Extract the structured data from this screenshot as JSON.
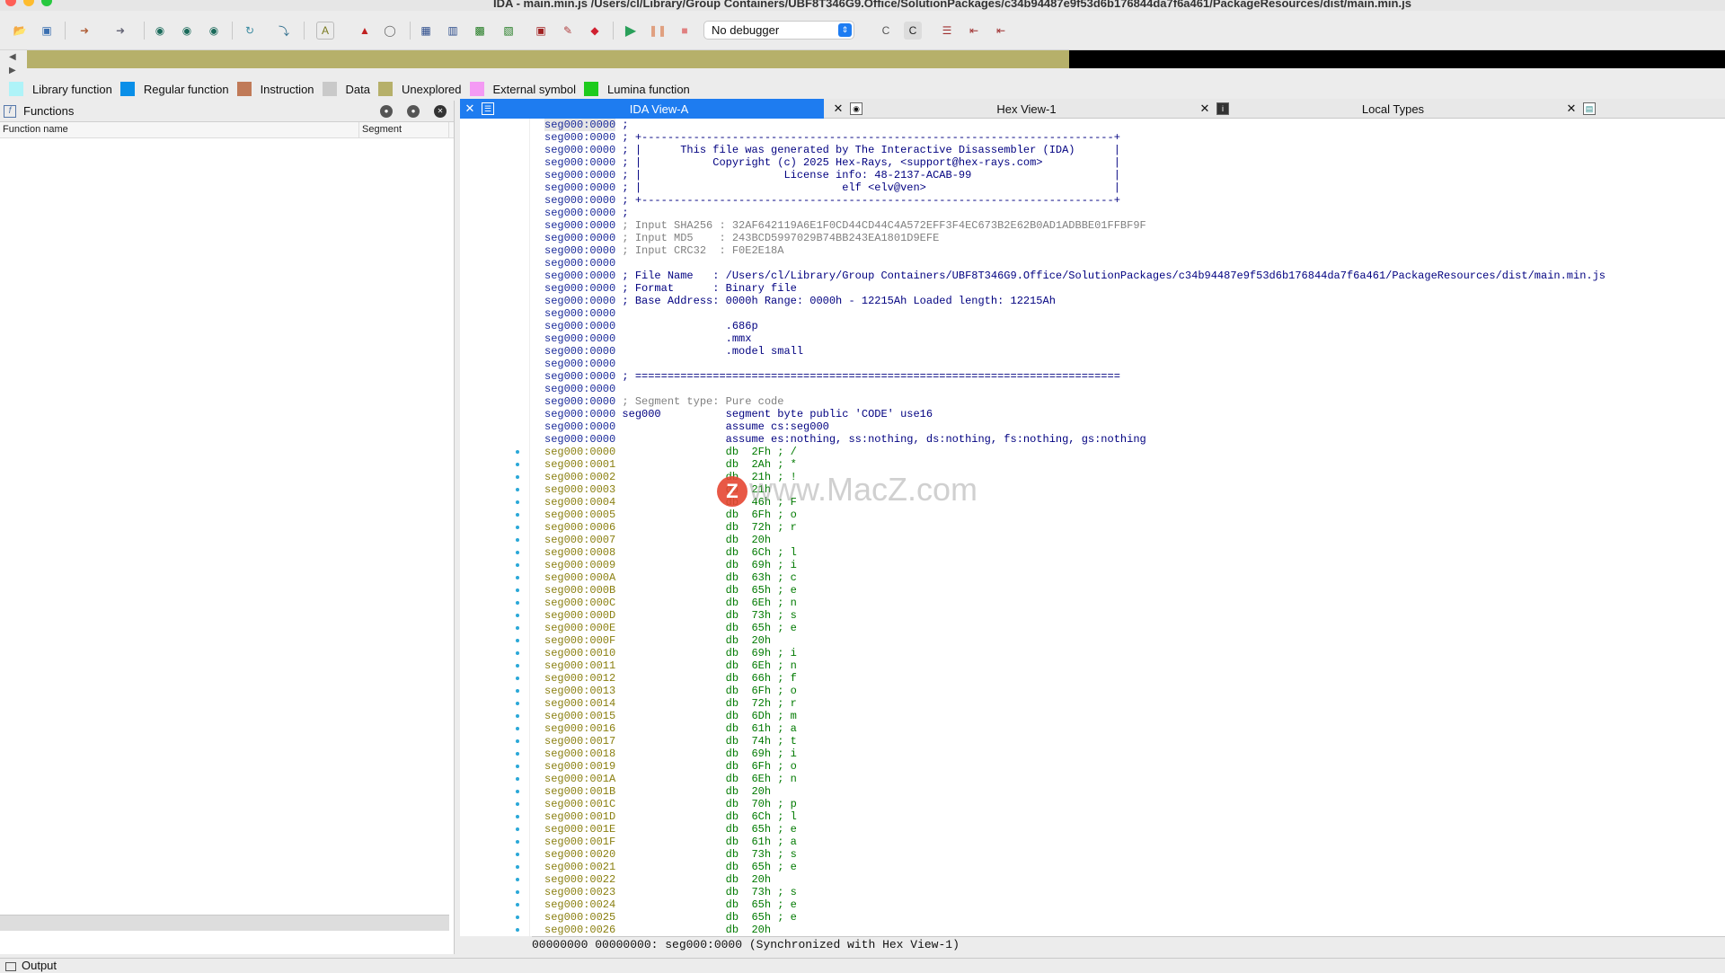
{
  "window": {
    "title": "IDA - main.min.js /Users/cl/Library/Group Containers/UBF8T346G9.Office/SolutionPackages/c34b94487e9f53d6b176844da7f6a461/PackageResources/dist/main.min.js"
  },
  "toolbar": {
    "debugger_value": "No debugger"
  },
  "legend": [
    {
      "label": "Library function",
      "color": "#aef3f8"
    },
    {
      "label": "Regular function",
      "color": "#0a8fe8"
    },
    {
      "label": "Instruction",
      "color": "#c07a58"
    },
    {
      "label": "Data",
      "color": "#c9c9c9"
    },
    {
      "label": "Unexplored",
      "color": "#b6b06a"
    },
    {
      "label": "External symbol",
      "color": "#f49af4"
    },
    {
      "label": "Lumina function",
      "color": "#1ecb1e"
    }
  ],
  "functions_panel": {
    "title": "Functions",
    "columns": [
      "Function name",
      "Segment"
    ]
  },
  "tabs": [
    {
      "label": "IDA View-A",
      "active": true
    },
    {
      "label": "Hex View-1",
      "active": false
    },
    {
      "label": "Local Types",
      "active": false
    }
  ],
  "listing": [
    {
      "addr": "seg000:0000",
      "text": " ;"
    },
    {
      "addr": "seg000:0000",
      "text": " ; +-------------------------------------------------------------------------+"
    },
    {
      "addr": "seg000:0000",
      "text": " ; |      This file was generated by The Interactive Disassembler (IDA)      |"
    },
    {
      "addr": "seg000:0000",
      "text": " ; |           Copyright (c) 2025 Hex-Rays, <support@hex-rays.com>           |"
    },
    {
      "addr": "seg000:0000",
      "text": " ; |                      License info: 48-2137-ACAB-99                      |"
    },
    {
      "addr": "seg000:0000",
      "text": " ; |                               elf <elv@ven>                             |"
    },
    {
      "addr": "seg000:0000",
      "text": " ; +-------------------------------------------------------------------------+"
    },
    {
      "addr": "seg000:0000",
      "text": " ;"
    },
    {
      "addr": "seg000:0000",
      "text": " ; Input SHA256 : 32AF642119A6E1F0CD44CD44C4A572EFF3F4EC673B2E62B0AD1ADBBE01FFBF9F",
      "kind": "c"
    },
    {
      "addr": "seg000:0000",
      "text": " ; Input MD5    : 243BCD5997029B74BB243EA1801D9EFE",
      "kind": "c"
    },
    {
      "addr": "seg000:0000",
      "text": " ; Input CRC32  : F0E2E18A",
      "kind": "c"
    },
    {
      "addr": "seg000:0000",
      "text": ""
    },
    {
      "addr": "seg000:0000",
      "text": " ; File Name   : /Users/cl/Library/Group Containers/UBF8T346G9.Office/SolutionPackages/c34b94487e9f53d6b176844da7f6a461/PackageResources/dist/main.min.js"
    },
    {
      "addr": "seg000:0000",
      "text": " ; Format      : Binary file"
    },
    {
      "addr": "seg000:0000",
      "text": " ; Base Address: 0000h Range: 0000h - 12215Ah Loaded length: 12215Ah"
    },
    {
      "addr": "seg000:0000",
      "text": ""
    },
    {
      "addr": "seg000:0000",
      "text": "                 .686p"
    },
    {
      "addr": "seg000:0000",
      "text": "                 .mmx"
    },
    {
      "addr": "seg000:0000",
      "text": "                 .model small"
    },
    {
      "addr": "seg000:0000",
      "text": ""
    },
    {
      "addr": "seg000:0000",
      "text": " ; ==========================================================================="
    },
    {
      "addr": "seg000:0000",
      "text": ""
    },
    {
      "addr": "seg000:0000",
      "text": " ; Segment type: Pure code",
      "kind": "c"
    },
    {
      "addr": "seg000:0000",
      "text": " seg000          segment byte public 'CODE' use16"
    },
    {
      "addr": "seg000:0000",
      "text": "                 assume cs:seg000"
    },
    {
      "addr": "seg000:0000",
      "text": "                 assume es:nothing, ss:nothing, ds:nothing, fs:nothing, gs:nothing"
    },
    {
      "addr": "seg000:0000",
      "text": "                 db  2Fh ; /",
      "kind": "db"
    },
    {
      "addr": "seg000:0001",
      "text": "                 db  2Ah ; *",
      "kind": "db"
    },
    {
      "addr": "seg000:0002",
      "text": "                 db  21h ; !",
      "kind": "db"
    },
    {
      "addr": "seg000:0003",
      "text": "                 db  21h",
      "kind": "db"
    },
    {
      "addr": "seg000:0004",
      "text": "                 db  46h ; F",
      "kind": "db"
    },
    {
      "addr": "seg000:0005",
      "text": "                 db  6Fh ; o",
      "kind": "db"
    },
    {
      "addr": "seg000:0006",
      "text": "                 db  72h ; r",
      "kind": "db"
    },
    {
      "addr": "seg000:0007",
      "text": "                 db  20h",
      "kind": "db"
    },
    {
      "addr": "seg000:0008",
      "text": "                 db  6Ch ; l",
      "kind": "db"
    },
    {
      "addr": "seg000:0009",
      "text": "                 db  69h ; i",
      "kind": "db"
    },
    {
      "addr": "seg000:000A",
      "text": "                 db  63h ; c",
      "kind": "db"
    },
    {
      "addr": "seg000:000B",
      "text": "                 db  65h ; e",
      "kind": "db"
    },
    {
      "addr": "seg000:000C",
      "text": "                 db  6Eh ; n",
      "kind": "db"
    },
    {
      "addr": "seg000:000D",
      "text": "                 db  73h ; s",
      "kind": "db"
    },
    {
      "addr": "seg000:000E",
      "text": "                 db  65h ; e",
      "kind": "db"
    },
    {
      "addr": "seg000:000F",
      "text": "                 db  20h",
      "kind": "db"
    },
    {
      "addr": "seg000:0010",
      "text": "                 db  69h ; i",
      "kind": "db"
    },
    {
      "addr": "seg000:0011",
      "text": "                 db  6Eh ; n",
      "kind": "db"
    },
    {
      "addr": "seg000:0012",
      "text": "                 db  66h ; f",
      "kind": "db"
    },
    {
      "addr": "seg000:0013",
      "text": "                 db  6Fh ; o",
      "kind": "db"
    },
    {
      "addr": "seg000:0014",
      "text": "                 db  72h ; r",
      "kind": "db"
    },
    {
      "addr": "seg000:0015",
      "text": "                 db  6Dh ; m",
      "kind": "db"
    },
    {
      "addr": "seg000:0016",
      "text": "                 db  61h ; a",
      "kind": "db"
    },
    {
      "addr": "seg000:0017",
      "text": "                 db  74h ; t",
      "kind": "db"
    },
    {
      "addr": "seg000:0018",
      "text": "                 db  69h ; i",
      "kind": "db"
    },
    {
      "addr": "seg000:0019",
      "text": "                 db  6Fh ; o",
      "kind": "db"
    },
    {
      "addr": "seg000:001A",
      "text": "                 db  6Eh ; n",
      "kind": "db"
    },
    {
      "addr": "seg000:001B",
      "text": "                 db  20h",
      "kind": "db"
    },
    {
      "addr": "seg000:001C",
      "text": "                 db  70h ; p",
      "kind": "db"
    },
    {
      "addr": "seg000:001D",
      "text": "                 db  6Ch ; l",
      "kind": "db"
    },
    {
      "addr": "seg000:001E",
      "text": "                 db  65h ; e",
      "kind": "db"
    },
    {
      "addr": "seg000:001F",
      "text": "                 db  61h ; a",
      "kind": "db"
    },
    {
      "addr": "seg000:0020",
      "text": "                 db  73h ; s",
      "kind": "db"
    },
    {
      "addr": "seg000:0021",
      "text": "                 db  65h ; e",
      "kind": "db"
    },
    {
      "addr": "seg000:0022",
      "text": "                 db  20h",
      "kind": "db"
    },
    {
      "addr": "seg000:0023",
      "text": "                 db  73h ; s",
      "kind": "db"
    },
    {
      "addr": "seg000:0024",
      "text": "                 db  65h ; e",
      "kind": "db"
    },
    {
      "addr": "seg000:0025",
      "text": "                 db  65h ; e",
      "kind": "db"
    },
    {
      "addr": "seg000:0026",
      "text": "                 db  20h",
      "kind": "db"
    }
  ],
  "status": {
    "text": "00000000 00000000: seg000:0000 (Synchronized with Hex View-1)"
  },
  "output": {
    "label": "Output"
  },
  "watermark": {
    "text": "www.MacZ.com",
    "badge": "Z"
  }
}
